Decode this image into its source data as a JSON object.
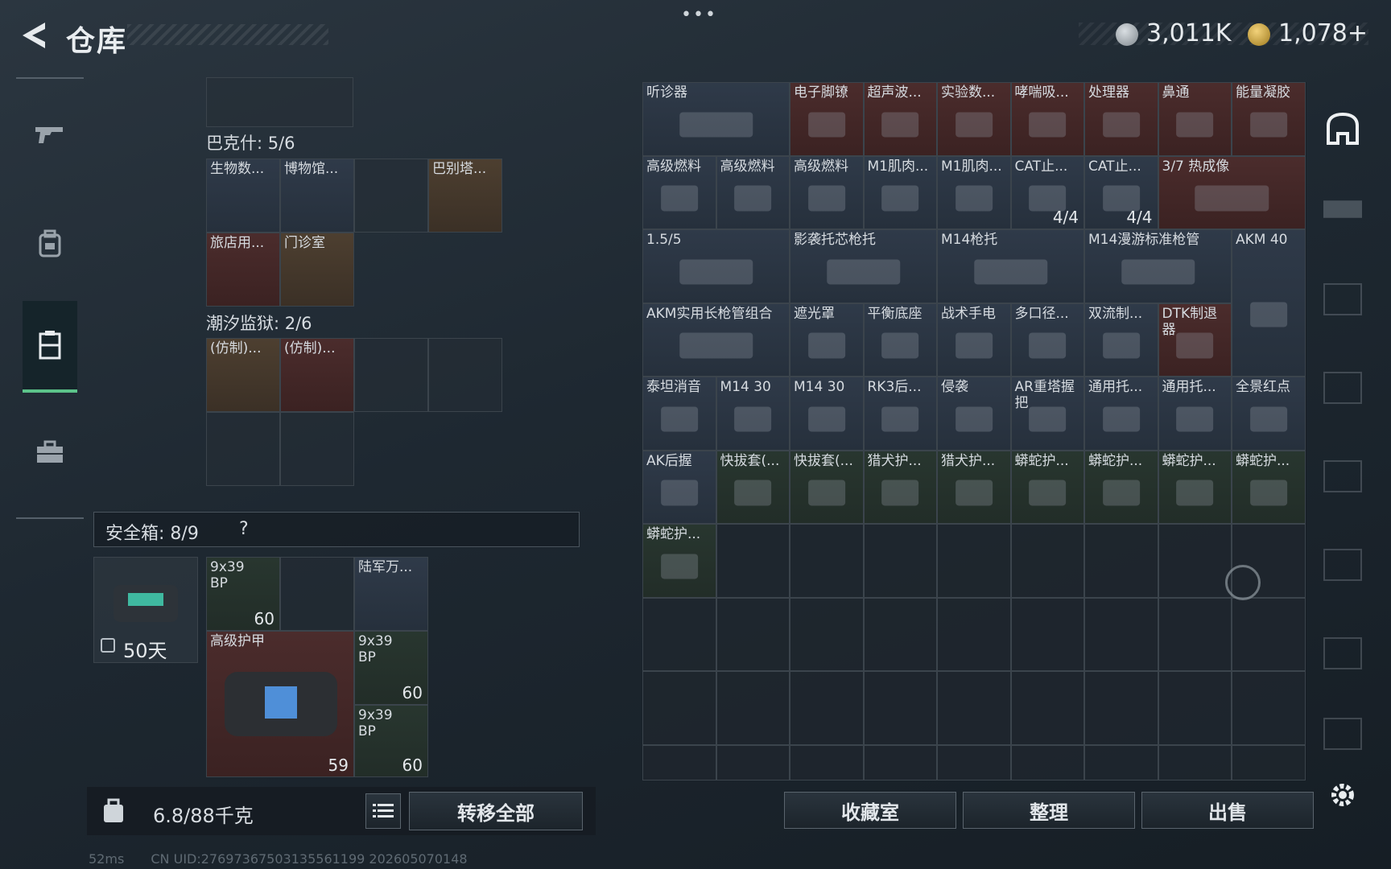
{
  "header": {
    "title": "仓库",
    "more": "•••"
  },
  "currency": [
    {
      "icon": "silver-coin-icon",
      "value": "3,011K",
      "color": "#9aa3aa"
    },
    {
      "icon": "gold-coin-icon",
      "value": "1,078+",
      "color": "#d2a73a"
    }
  ],
  "nav": [
    {
      "icon": "gun-icon",
      "active": false
    },
    {
      "icon": "backpack-icon",
      "active": false
    },
    {
      "icon": "inventory-icon",
      "active": true
    },
    {
      "icon": "briefcase-icon",
      "active": false
    }
  ],
  "containers": {
    "bakshi": {
      "label": "巴克什: 5/6",
      "items": [
        "生物数...",
        "博物馆...",
        "",
        "巴别塔...",
        "旅店用...",
        "门诊室"
      ]
    },
    "tide": {
      "label": "潮汐监狱: 2/6",
      "items": [
        "(仿制)...",
        "(仿制)..."
      ]
    }
  },
  "safe": {
    "label": "安全箱: 8/9",
    "help": "?",
    "duration": "50天",
    "items": {
      "ammo1": {
        "name": "9x39",
        "sub": "BP",
        "count": "60"
      },
      "radio": {
        "name": "陆军万..."
      },
      "armor": {
        "name": "高级护甲",
        "count": "59"
      },
      "ammo2": {
        "name": "9x39",
        "sub": "BP",
        "count": "60"
      },
      "ammo3": {
        "name": "9x39",
        "sub": "BP",
        "count": "60"
      }
    }
  },
  "bottom": {
    "weight": "6.8/88千克",
    "transfer_all": "转移全部"
  },
  "stash": [
    [
      "听诊器",
      "电子脚镣",
      "超声波...",
      "实验数...",
      "哮喘吸...",
      "处理器",
      "鼻通",
      "能量凝胶"
    ],
    [
      "高级燃料",
      "高级燃料",
      "高级燃料",
      "M1肌肉...",
      "M1肌肉...",
      "CAT止...",
      "CAT止...",
      "3/7 热成像"
    ],
    [
      "1.5/5",
      "影袭托芯枪托",
      "M14枪托",
      "M14漫游标准枪管",
      "AKM 40"
    ],
    [
      "AKM实用长枪管组合",
      "遮光罩",
      "平衡底座",
      "战术手电",
      "多口径...",
      "双流制...",
      "DTK制退器"
    ],
    [
      "泰坦消音",
      "M14 30",
      "M14 30",
      "RK3后...",
      "侵袭",
      "AR重塔握把",
      "通用托...",
      "通用托...",
      "全景红点"
    ],
    [
      "AK后握",
      "快拔套(...",
      "快拔套(...",
      "猎犬护...",
      "猎犬护...",
      "蟒蛇护...",
      "蟒蛇护...",
      "蟒蛇护...",
      "蟒蛇护..."
    ],
    [
      "蟒蛇护..."
    ]
  ],
  "stash_counts": {
    "cat1": "4/4",
    "cat2": "4/4"
  },
  "actions": {
    "collection": "收藏室",
    "organize": "整理",
    "sell": "出售"
  },
  "footer": {
    "ping": "52ms",
    "uid": "CN UID:276973675031355611​99 202605070148"
  }
}
